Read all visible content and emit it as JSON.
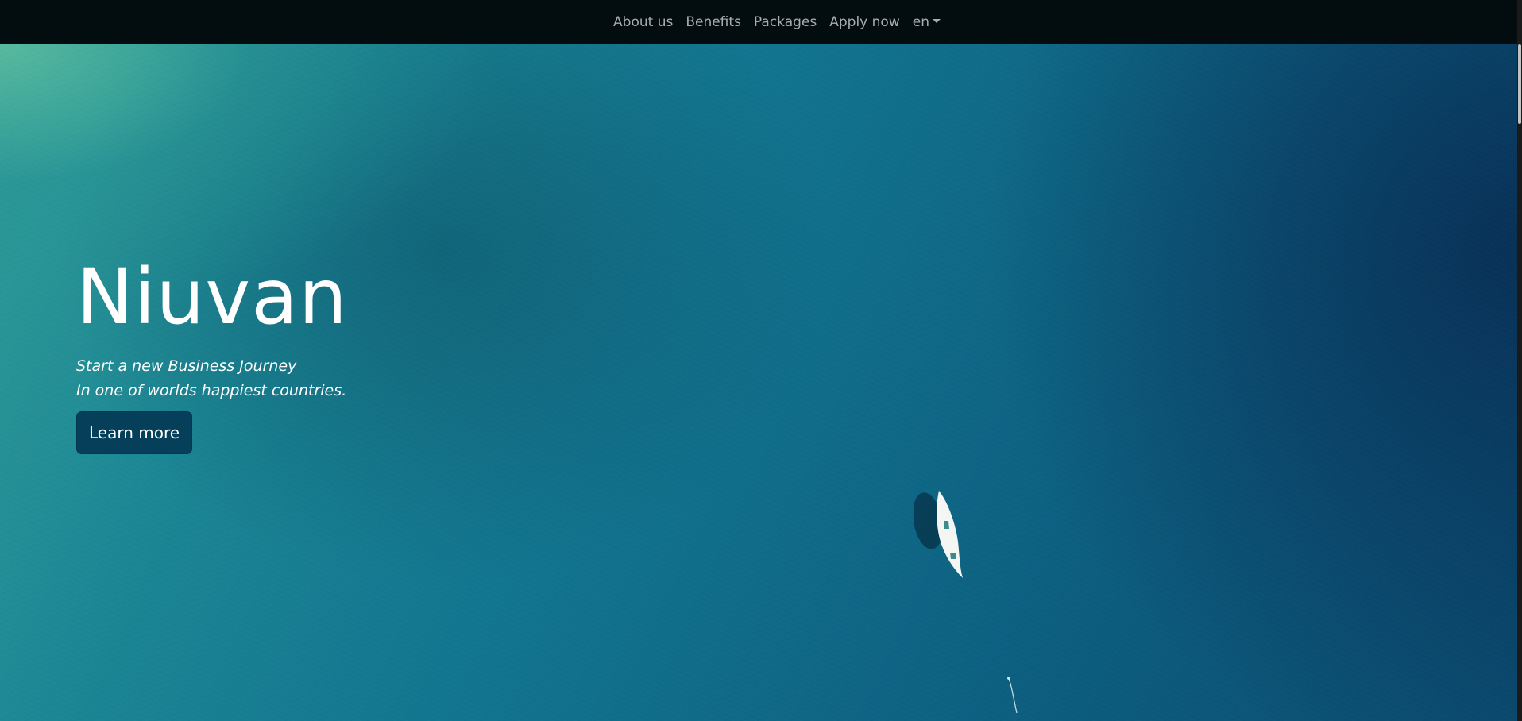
{
  "nav": {
    "items": [
      {
        "label": "About us"
      },
      {
        "label": "Benefits"
      },
      {
        "label": "Packages"
      },
      {
        "label": "Apply now"
      }
    ],
    "language": "en"
  },
  "hero": {
    "title": "Niuvan",
    "subtitle_line1": "Start a new Business Journey",
    "subtitle_line2": "In one of worlds happiest countries.",
    "cta_label": "Learn more"
  },
  "colors": {
    "navbar_bg": "#030d10",
    "nav_text": "#a8adb0",
    "button_bg": "#063f5a",
    "hero_text": "#ffffff"
  },
  "icons": {
    "language_dropdown": "caret-down-icon"
  }
}
